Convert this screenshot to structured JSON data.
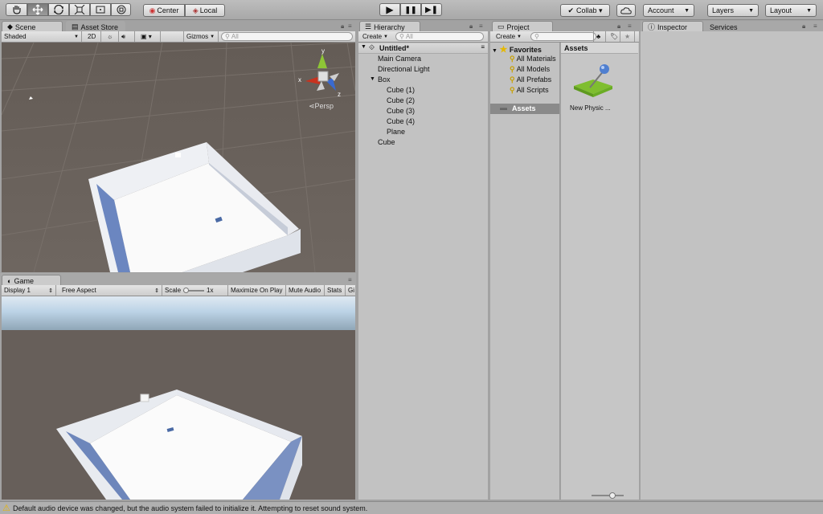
{
  "toolbar": {
    "tools": [
      "hand-tool-icon",
      "move-tool-icon",
      "rotate-tool-icon",
      "scale-tool-icon",
      "rect-tool-icon",
      "transform-tool-icon"
    ],
    "pivot_label": "Center",
    "space_label": "Local",
    "play_icon": "▶",
    "pause_icon": "❚❚",
    "step_icon": "▶❚",
    "collab_label": "Collab ▾",
    "account_label": "Account",
    "layers_label": "Layers",
    "layout_label": "Layout"
  },
  "scene": {
    "tab_label": "Scene",
    "asset_store_tab": "Asset Store",
    "shading": "Shaded",
    "mode_2d": "2D",
    "gizmos": "Gizmos",
    "search_placeholder": "All",
    "persp_label": "Persp",
    "axis_x": "x",
    "axis_y": "y",
    "axis_z": "z"
  },
  "game": {
    "tab_label": "Game",
    "display": "Display 1",
    "aspect": "Free Aspect",
    "scale_label": "Scale",
    "scale_value": "1x",
    "maximize": "Maximize On Play",
    "mute": "Mute Audio",
    "stats": "Stats",
    "gizmos": "Gi"
  },
  "hierarchy": {
    "tab_label": "Hierarchy",
    "create": "Create",
    "search_placeholder": "All",
    "scene_name": "Untitled*",
    "items": [
      {
        "label": "Main Camera",
        "depth": 1
      },
      {
        "label": "Directional Light",
        "depth": 1
      },
      {
        "label": "Box",
        "depth": 1
      },
      {
        "label": "Cube (1)",
        "depth": 2
      },
      {
        "label": "Cube (2)",
        "depth": 2
      },
      {
        "label": "Cube (3)",
        "depth": 2
      },
      {
        "label": "Cube (4)",
        "depth": 2
      },
      {
        "label": "Plane",
        "depth": 2
      },
      {
        "label": "Cube",
        "depth": 1
      }
    ]
  },
  "project": {
    "tab_label": "Project",
    "create": "Create",
    "favorites_label": "Favorites",
    "favorites": [
      "All Materials",
      "All Models",
      "All Prefabs",
      "All Scripts"
    ],
    "assets_folder": "Assets",
    "assets_header": "Assets",
    "asset_items": [
      {
        "label": "New Physic ...",
        "icon": "physic-material-icon"
      }
    ]
  },
  "inspector": {
    "tab_label": "Inspector",
    "services_tab": "Services"
  },
  "status_bar": {
    "message": "Default audio device was changed, but the audio system failed to initialize it. Attempting to reset sound system."
  }
}
